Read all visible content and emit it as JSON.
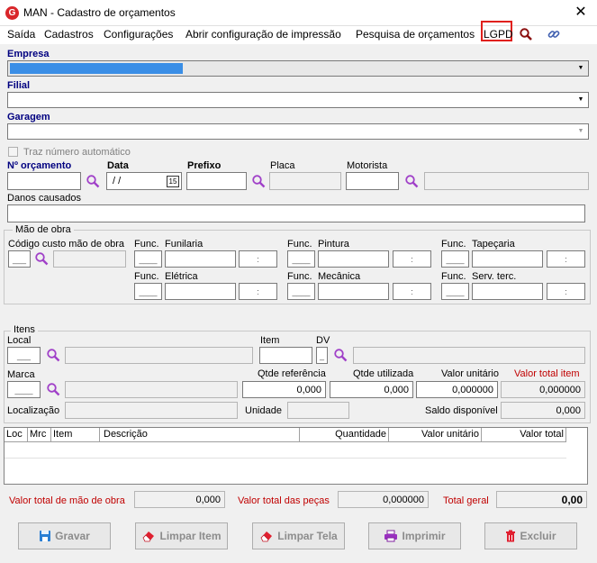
{
  "window": {
    "title": "MAN - Cadastro de orçamentos",
    "close": "✕"
  },
  "menu": [
    "Saída",
    "Cadastros",
    "Configurações",
    "Abrir configuração de impressão",
    "Pesquisa de orçamentos",
    "LGPD"
  ],
  "empresa": {
    "label": "Empresa"
  },
  "filial": {
    "label": "Filial"
  },
  "garagem": {
    "label": "Garagem"
  },
  "traz_numero": {
    "label": "Traz número automático"
  },
  "orcamento": {
    "numero_label": "Nº orçamento",
    "data_label": "Data",
    "data_value": " /  /",
    "cal_day": "15",
    "prefixo_label": "Prefixo",
    "placa_label": "Placa",
    "motorista_label": "Motorista"
  },
  "danos": {
    "label": "Danos causados"
  },
  "mao_obra": {
    "title": "Mão de obra",
    "codigo_label": "Código custo mão de obra",
    "codigo_value": "___",
    "func_label": "Func.",
    "sections": [
      "Funilaria",
      "Pintura",
      "Tapeçaria",
      "Elétrica",
      "Mecânica",
      "Serv. terc."
    ],
    "func_value": "____",
    "time_value": ":"
  },
  "itens": {
    "title": "Itens",
    "local_label": "Local",
    "local_value": "___",
    "item_label": "Item",
    "dv_label": "DV",
    "dv_value": "_",
    "marca_label": "Marca",
    "marca_value": "____",
    "qtde_ref_label": "Qtde referência",
    "qtde_ref_value": "0,000",
    "qtde_util_label": "Qtde utilizada",
    "qtde_util_value": "0,000",
    "valor_unit_label": "Valor unitário",
    "valor_unit_value": "0,000000",
    "valor_total_label": "Valor total item",
    "valor_total_value": "0,000000",
    "localizacao_label": "Localização",
    "unidade_label": "Unidade",
    "saldo_label": "Saldo disponível",
    "saldo_value": "0,000"
  },
  "table": {
    "headers": [
      "Loc",
      "Mrc",
      "Item",
      "Descrição",
      "Quantidade",
      "Valor unitário",
      "Valor total"
    ]
  },
  "totals": {
    "mao_obra_label": "Valor total de mão de obra",
    "mao_obra_value": "0,000",
    "pecas_label": "Valor total das peças",
    "pecas_value": "0,000000",
    "geral_label": "Total geral",
    "geral_value": "0,00"
  },
  "buttons": {
    "gravar": "Gravar",
    "limpar_item": "Limpar Item",
    "limpar_tela": "Limpar Tela",
    "imprimir": "Imprimir",
    "excluir": "Excluir"
  },
  "colors": {
    "label_blue": "#000080",
    "label_red": "#c00000",
    "accent_purple": "#a040c8",
    "highlight_red": "#e0201c"
  }
}
